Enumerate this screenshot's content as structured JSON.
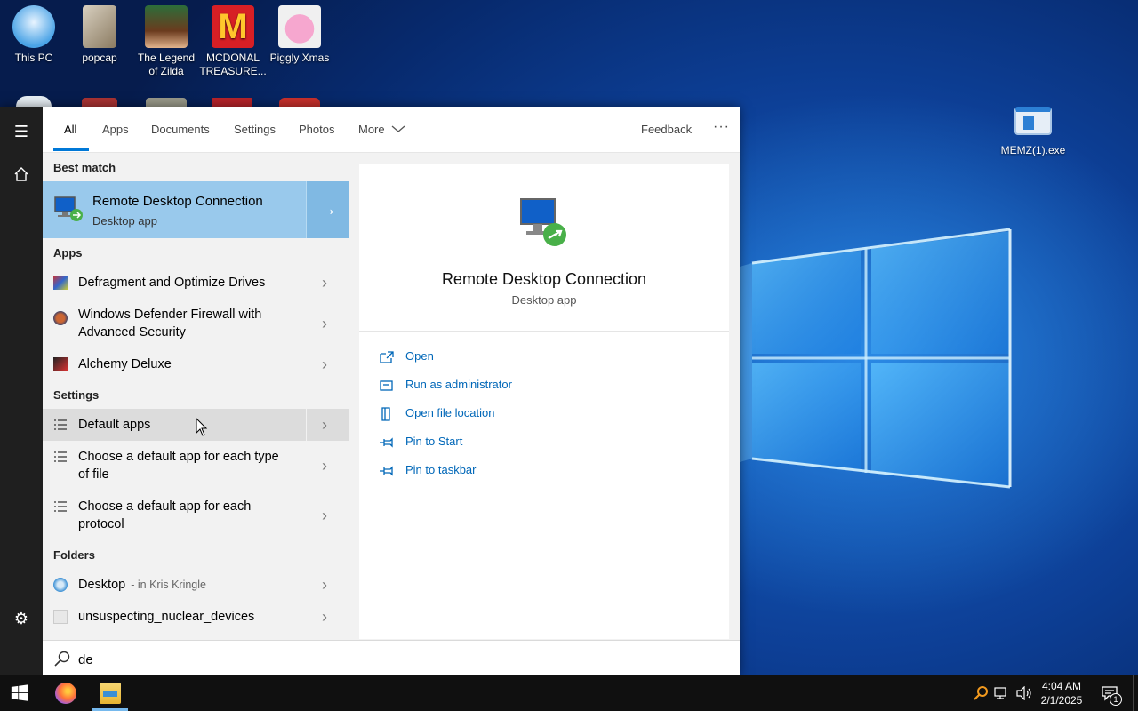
{
  "desktop": {
    "icons_row1": [
      {
        "label": "This PC"
      },
      {
        "label": "popcap"
      },
      {
        "label": "The Legend of Zilda"
      },
      {
        "label": "MCDONAL TREASURE..."
      },
      {
        "label": "Piggly Xmas"
      }
    ],
    "right_icon": {
      "label": "MEMZ(1).exe"
    }
  },
  "search": {
    "tabs": [
      "All",
      "Apps",
      "Documents",
      "Settings",
      "Photos",
      "More"
    ],
    "feedback_label": "Feedback",
    "more_options_label": "···",
    "best_match_label": "Best match",
    "best_match": {
      "title": "Remote Desktop Connection",
      "subtitle": "Desktop app"
    },
    "apps_label": "Apps",
    "apps": [
      {
        "line1": "Defragment and Optimize Drives"
      },
      {
        "line1": "Windows Defender Firewall with",
        "line2": "Advanced Security"
      },
      {
        "line1": "Alchemy Deluxe"
      }
    ],
    "settings_label": "Settings",
    "settings": [
      {
        "line1": "Default apps"
      },
      {
        "line1": "Choose a default app for each type",
        "line2": "of file"
      },
      {
        "line1": "Choose a default app for each",
        "line2": "protocol"
      }
    ],
    "folders_label": "Folders",
    "folders": [
      {
        "name": "Desktop",
        "location": "- in Kris Kringle"
      },
      {
        "name": "unsuspecting_nuclear_devices"
      }
    ],
    "query": "de"
  },
  "preview": {
    "title": "Remote Desktop Connection",
    "subtitle": "Desktop app",
    "actions": [
      "Open",
      "Run as administrator",
      "Open file location",
      "Pin to Start",
      "Pin to taskbar"
    ]
  },
  "taskbar": {
    "time": "4:04 AM",
    "date": "2/1/2025",
    "notification_count": "1"
  },
  "colors": {
    "accent": "#0078d7",
    "selection": "#99c9ec",
    "link": "#0067b8"
  }
}
